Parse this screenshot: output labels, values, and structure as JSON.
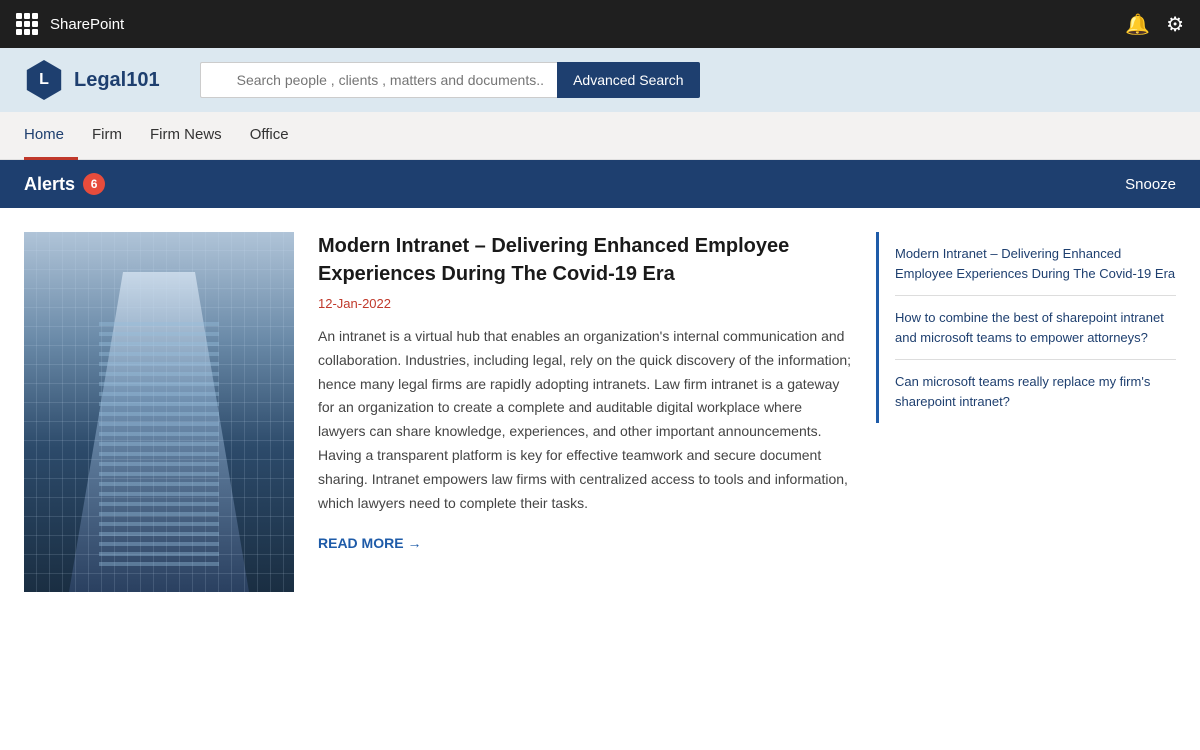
{
  "topBar": {
    "title": "SharePoint",
    "bellLabel": "🔔",
    "settingsLabel": "⚙"
  },
  "subHeader": {
    "logoLetter": "L",
    "logoText": "Legal101",
    "searchPlaceholder": "Search people , clients , matters and documents...",
    "advancedSearchLabel": "Advanced Search"
  },
  "navMenu": {
    "items": [
      {
        "label": "Home",
        "active": true
      },
      {
        "label": "Firm",
        "active": false
      },
      {
        "label": "Firm News",
        "active": false
      },
      {
        "label": "Office",
        "active": false
      }
    ]
  },
  "alertsBar": {
    "label": "Alerts",
    "count": "6",
    "snoozeLabel": "Snooze"
  },
  "article": {
    "title": "Modern Intranet – Delivering Enhanced Employee Experiences During The Covid-19 Era",
    "date": "12-Jan-2022",
    "body": "An intranet is a virtual hub that enables an organization's internal communication and collaboration. Industries, including legal, rely on the quick discovery of the information; hence many legal firms are rapidly adopting intranets. Law firm intranet is a gateway for an organization to create a complete and auditable digital workplace where lawyers can share knowledge, experiences, and other important announcements. Having a transparent platform is key for effective teamwork and secure document sharing. Intranet empowers law firms with centralized access to tools and information, which lawyers need to complete their tasks.",
    "readMore": "READ MORE →"
  },
  "sidebar": {
    "items": [
      {
        "text": "Modern Intranet – Delivering Enhanced Employee Experiences During The Covid-19 Era"
      },
      {
        "text": "How to combine the best of sharepoint intranet and microsoft teams to empower attorneys?"
      },
      {
        "text": "Can microsoft teams really replace my firm's sharepoint intranet?"
      }
    ]
  }
}
